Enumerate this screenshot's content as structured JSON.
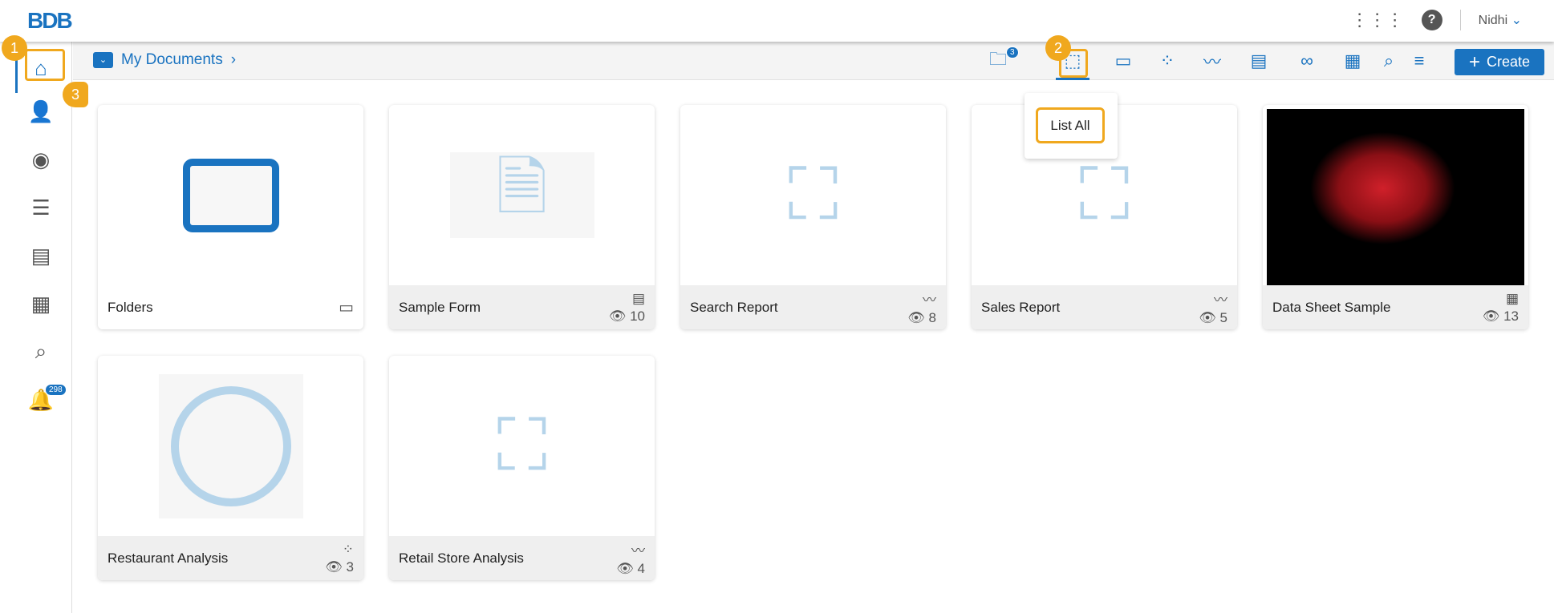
{
  "header": {
    "logo": "BDB",
    "user": "Nidhi"
  },
  "sidebar": {
    "notifications_count": "298"
  },
  "toolbar": {
    "breadcrumb": "My Documents",
    "shared_count": "3",
    "create_label": "Create",
    "popup_item": "List All"
  },
  "annotations": [
    "1",
    "2",
    "3"
  ],
  "cards": [
    {
      "title": "Folders",
      "type": "folder",
      "views": null
    },
    {
      "title": "Sample Form",
      "type": "form",
      "views": "10"
    },
    {
      "title": "Search Report",
      "type": "report",
      "views": "8"
    },
    {
      "title": "Sales Report",
      "type": "report",
      "views": "5"
    },
    {
      "title": "Data Sheet Sample",
      "type": "datasheet",
      "views": "13"
    },
    {
      "title": "Restaurant Analysis",
      "type": "dashboard",
      "views": "3"
    },
    {
      "title": "Retail Store Analysis",
      "type": "report",
      "views": "4"
    }
  ],
  "colors": {
    "accent": "#1a73c0",
    "highlight": "#f0a81e"
  }
}
